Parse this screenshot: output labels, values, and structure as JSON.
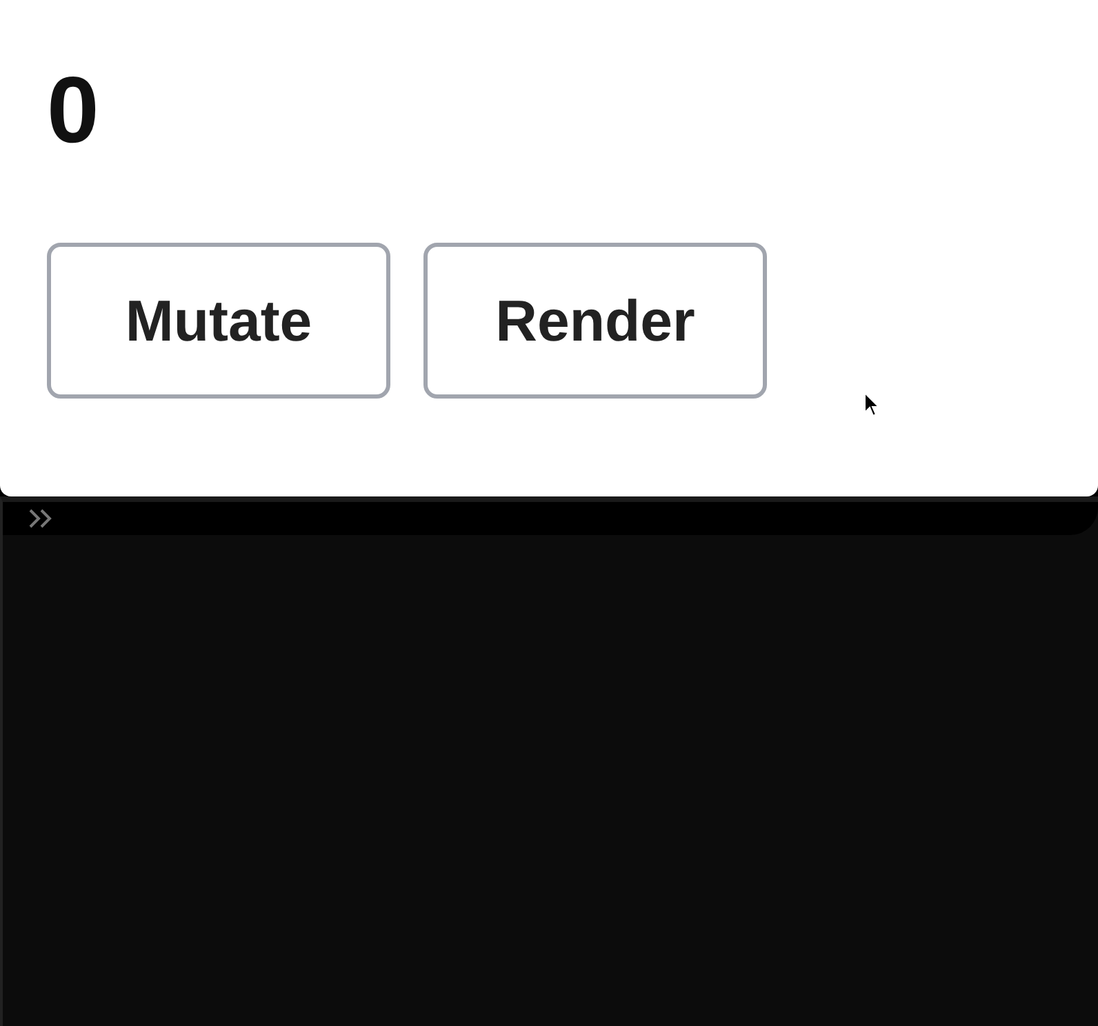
{
  "counter": "0",
  "buttons": [
    "Mutate",
    "Render"
  ]
}
